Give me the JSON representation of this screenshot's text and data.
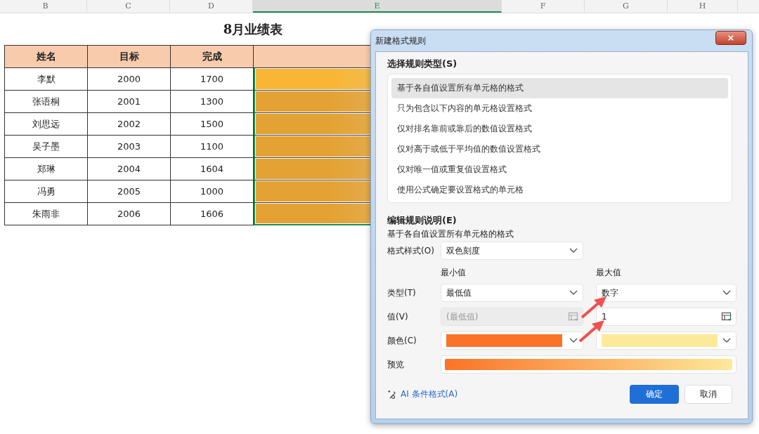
{
  "sheet": {
    "columns": [
      {
        "label": "B",
        "selected": false
      },
      {
        "label": "C",
        "selected": false
      },
      {
        "label": "D",
        "selected": false
      },
      {
        "label": "E",
        "selected": true
      },
      {
        "label": "F",
        "selected": false
      },
      {
        "label": "G",
        "selected": false
      },
      {
        "label": "H",
        "selected": false
      }
    ],
    "title": "8月业绩表",
    "header": [
      "姓名",
      "目标",
      "完成"
    ],
    "rows": [
      {
        "name": "李默",
        "target": "2000",
        "done": "1700",
        "color": "#f8b634"
      },
      {
        "name": "张语桐",
        "target": "2001",
        "done": "1300",
        "color": "#e3a233"
      },
      {
        "name": "刘思远",
        "target": "2002",
        "done": "1500",
        "color": "#e3a233"
      },
      {
        "name": "吴子墨",
        "target": "2003",
        "done": "1100",
        "color": "#e3a233"
      },
      {
        "name": "郑琳",
        "target": "2004",
        "done": "1604",
        "color": "#e3a233"
      },
      {
        "name": "冯勇",
        "target": "2005",
        "done": "1000",
        "color": "#e3a233"
      },
      {
        "name": "朱雨非",
        "target": "2006",
        "done": "1606",
        "color": "#e3a233"
      }
    ]
  },
  "dialog": {
    "title": "新建格式规则",
    "close": "×",
    "rule_types_label": "选择规则类型(S)",
    "rule_types": [
      {
        "label": "基于各自值设置所有单元格的格式",
        "selected": true
      },
      {
        "label": "只为包含以下内容的单元格设置格式",
        "selected": false
      },
      {
        "label": "仅对排名靠前或靠后的数值设置格式",
        "selected": false
      },
      {
        "label": "仅对高于或低于平均值的数值设置格式",
        "selected": false
      },
      {
        "label": "仅对唯一值或重复值设置格式",
        "selected": false
      },
      {
        "label": "使用公式确定要设置格式的单元格",
        "selected": false
      }
    ],
    "edit_label": "编辑规则说明(E)",
    "description": "基于各自值设置所有单元格的格式",
    "style_label": "格式样式(O)",
    "style_value": "双色刻度",
    "type_label": "类型(T)",
    "value_label": "值(V)",
    "color_label": "颜色(C)",
    "scale": [
      {
        "heading": "最小值",
        "type": "最低值",
        "placeholder": "(最低值)",
        "disabled": true,
        "color": "#fa7328"
      },
      {
        "heading": "最大值",
        "type": "数字",
        "value": "1",
        "disabled": false,
        "color": "#fde99a"
      }
    ],
    "preview_label": "预览",
    "ai_link": "AI 条件格式(A)",
    "ok": "确定",
    "cancel": "取消"
  }
}
